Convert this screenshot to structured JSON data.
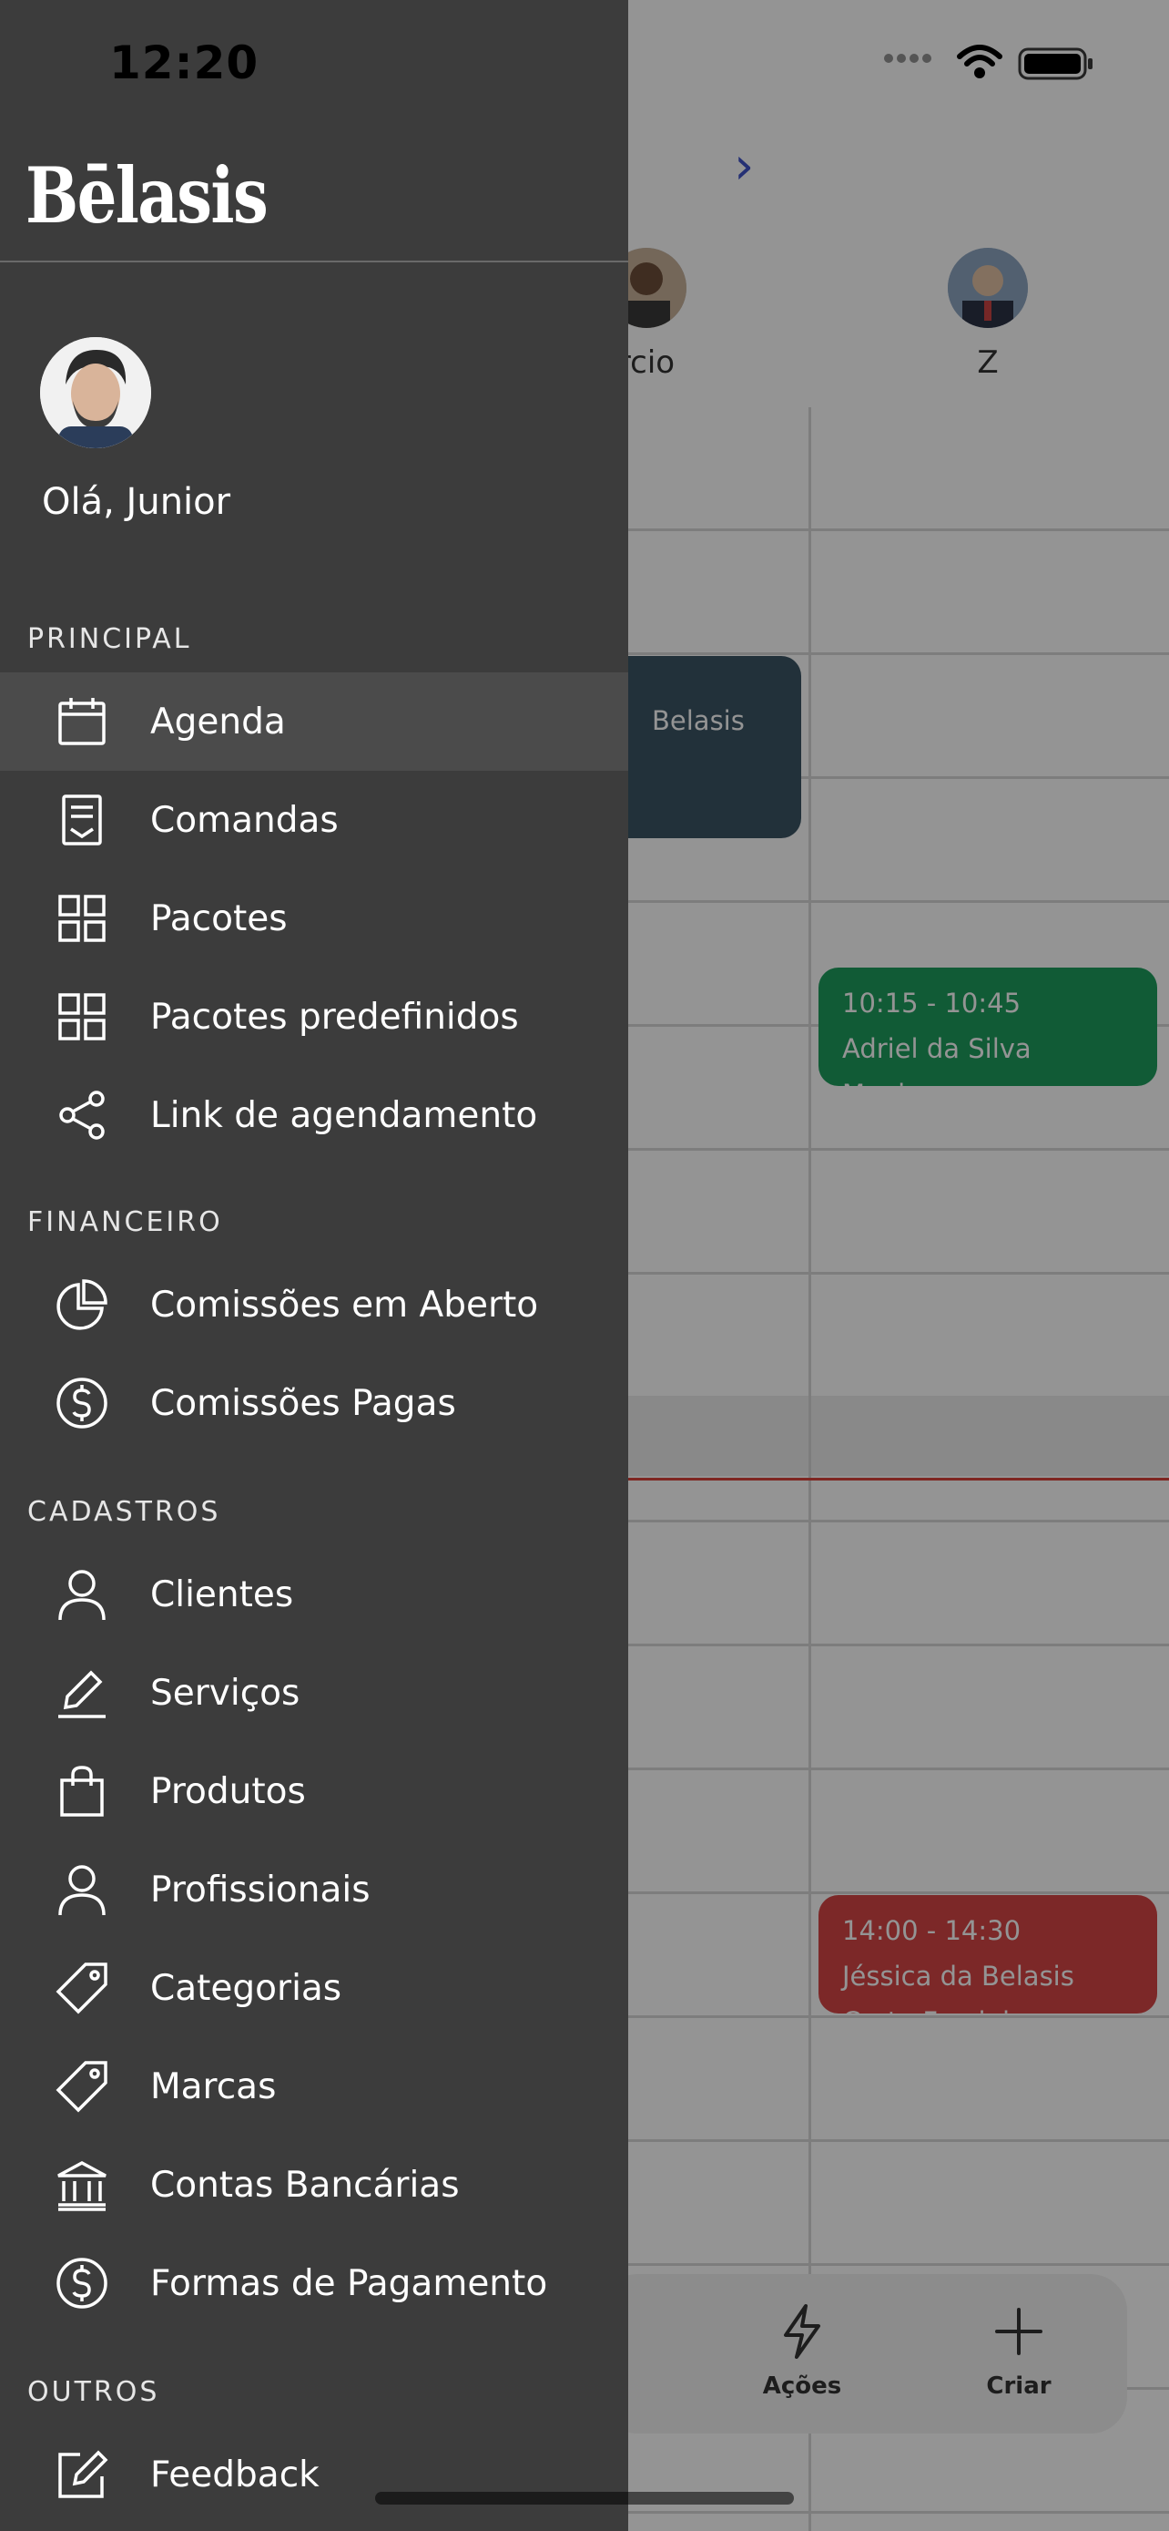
{
  "status_bar": {
    "time": "12:20"
  },
  "brand": {
    "logo_text": "Bēlasis"
  },
  "user": {
    "greeting": "Olá, Junior"
  },
  "menu": {
    "sections": [
      {
        "title": "PRINCIPAL"
      },
      {
        "title": "FINANCEIRO"
      },
      {
        "title": "CADASTROS"
      },
      {
        "title": "OUTROS"
      }
    ],
    "items": [
      {
        "label": "Agenda",
        "icon": "calendar-icon",
        "active": true
      },
      {
        "label": "Comandas",
        "icon": "receipt-icon"
      },
      {
        "label": "Pacotes",
        "icon": "grid-icon"
      },
      {
        "label": "Pacotes predefinidos",
        "icon": "grid-icon"
      },
      {
        "label": "Link de agendamento",
        "icon": "share-icon"
      },
      {
        "label": "Comissões em Aberto",
        "icon": "pie-chart-icon"
      },
      {
        "label": "Comissões Pagas",
        "icon": "dollar-circle-icon"
      },
      {
        "label": "Clientes",
        "icon": "user-icon"
      },
      {
        "label": "Serviços",
        "icon": "pen-icon"
      },
      {
        "label": "Produtos",
        "icon": "shopping-bag-icon"
      },
      {
        "label": "Profissionais",
        "icon": "user-icon"
      },
      {
        "label": "Categorias",
        "icon": "tag-icon"
      },
      {
        "label": "Marcas",
        "icon": "tag-icon"
      },
      {
        "label": "Contas Bancárias",
        "icon": "bank-icon"
      },
      {
        "label": "Formas de Pagamento",
        "icon": "dollar-circle-icon"
      },
      {
        "label": "Feedback",
        "icon": "edit-icon"
      }
    ]
  },
  "calendar": {
    "staff": [
      {
        "name": "rcio"
      },
      {
        "name": "Z"
      }
    ],
    "events": [
      {
        "title": "Belasis",
        "color": "#3b5565"
      },
      {
        "time": "10:15 - 10:45",
        "client": "Adriel da Silva",
        "service": "Manicure",
        "color": "#1e9d5e"
      },
      {
        "time": "14:00 - 14:30",
        "client": "Jéssica da Belasis",
        "service": "Corte Feminino",
        "color": "#d64545"
      }
    ],
    "bottom_actions": [
      {
        "label": "Ações",
        "icon": "lightning-icon"
      },
      {
        "label": "Criar",
        "icon": "plus-icon"
      }
    ]
  },
  "colors": {
    "drawer_bg": "#3c3c3c",
    "active_item_bg": "#4b4b4b",
    "accent_nav": "#4054c9",
    "now_line": "#d9433a"
  }
}
